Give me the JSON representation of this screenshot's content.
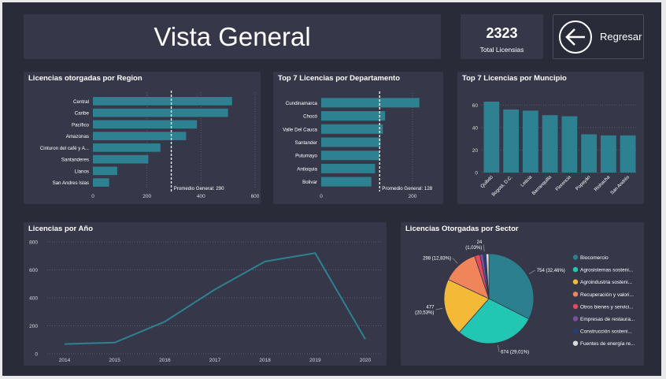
{
  "header": {
    "title": "Vista General"
  },
  "kpi": {
    "value": "2323",
    "label": "Total Licensias"
  },
  "back_button": {
    "label": "Regresar"
  },
  "colors": {
    "bar": "#2d8190",
    "line": "#2d8190",
    "avg": "#ffffff"
  },
  "chart_data": [
    {
      "type": "bar",
      "orientation": "horizontal",
      "title": "Licencias otorgadas por Region",
      "categories": [
        "Central",
        "Caribe",
        "Pacífico",
        "Amazonas",
        "Cinturon del café y A...",
        "Santanderes",
        "Llanos",
        "San Andres Islas"
      ],
      "values": [
        515,
        500,
        385,
        345,
        250,
        205,
        90,
        60
      ],
      "xlim": [
        0,
        600
      ],
      "xticks": [
        "0",
        "200",
        "400",
        "600"
      ],
      "average": 290,
      "average_label": "Promedio General: 290"
    },
    {
      "type": "bar",
      "orientation": "horizontal",
      "title": "Top 7 Licencias por Departamento",
      "categories": [
        "Cundinamarca",
        "Chocó",
        "Valle Del Cauca",
        "Santander",
        "Putumayo",
        "Antioquia",
        "Bolivar"
      ],
      "values": [
        215,
        140,
        135,
        130,
        128,
        118,
        110
      ],
      "xlim": [
        0,
        250
      ],
      "xticks": [
        "0",
        "200"
      ],
      "average": 128,
      "average_label": "Promedio General: 128"
    },
    {
      "type": "bar",
      "orientation": "vertical",
      "title": "Top 7 Licencias por Muncipio",
      "categories": [
        "Quibdó",
        "Bogotá, D.C.",
        "Leticia",
        "Barranquilla",
        "Florencia",
        "Popayán",
        "Riohacha",
        "San Andrés"
      ],
      "values": [
        63,
        56,
        55,
        51,
        50,
        34,
        33,
        33
      ],
      "ylim": [
        0,
        70
      ],
      "yticks": [
        "0",
        "20",
        "40",
        "60"
      ]
    },
    {
      "type": "line",
      "title": "Licencias por Año",
      "x": [
        "2014",
        "2015",
        "2016",
        "2017",
        "2018",
        "2019",
        "2020"
      ],
      "y": [
        70,
        80,
        230,
        460,
        660,
        720,
        105
      ],
      "ylim": [
        0,
        800
      ],
      "yticks": [
        "0",
        "200",
        "400",
        "600",
        "800"
      ]
    },
    {
      "type": "pie",
      "title": "Licencias Otorgadas por Sector",
      "slices": [
        {
          "name": "Biocomercio",
          "value": 754,
          "label": "754 (32,46%)",
          "color": "#2b7f8e"
        },
        {
          "name": "Agrosistemas sosteni...",
          "value": 674,
          "label": "674 (29,01%)",
          "color": "#21c7b3"
        },
        {
          "name": "Agroindustria sosteni...",
          "value": 477,
          "label": "477\n(20,53%)",
          "color": "#f5b938"
        },
        {
          "name": "Recuperación y valori...",
          "value": 298,
          "label": "298 (12,83%)",
          "color": "#f0845b"
        },
        {
          "name": "Otros bienes y servici...",
          "value": 45,
          "label": "",
          "color": "#e4495f"
        },
        {
          "name": "Empresas de restaura...",
          "value": 27,
          "label": "",
          "color": "#7c4e9e"
        },
        {
          "name": "Construcción sosteni...",
          "value": 24,
          "label": "24\n(1,03%)",
          "color": "#243e7a"
        },
        {
          "name": "Fuentes de energía re...",
          "value": 24,
          "label": "",
          "color": "#d9d9d9"
        }
      ],
      "legend_position": "right"
    }
  ]
}
